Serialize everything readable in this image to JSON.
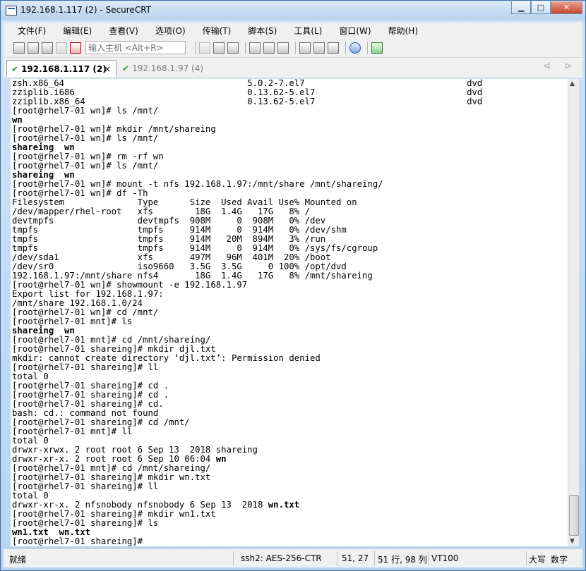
{
  "window": {
    "title": "192.168.1.117 (2) - SecureCRT",
    "minimize": "▁",
    "maximize": "□",
    "close": "✕"
  },
  "menu": [
    "文件(F)",
    "编辑(E)",
    "查看(V)",
    "选项(O)",
    "传输(T)",
    "脚本(S)",
    "工具(L)",
    "窗口(W)",
    "帮助(H)"
  ],
  "toolbar": {
    "host_input_placeholder": "输入主机 <Alt+R>"
  },
  "tabs": [
    {
      "label": "192.168.1.117 (2)",
      "close": "×",
      "status": "✔"
    },
    {
      "label": "192.168.1.97 (4)",
      "status": "✔"
    }
  ],
  "tab_nav": "◁ ▷",
  "terminal": {
    "lines": [
      {
        "t": "zsh.x86_64                                   5.0.2-7.el7                               dvd"
      },
      {
        "t": "zziplib.i686                                 0.13.62-5.el7                             dvd"
      },
      {
        "t": "zziplib.x86_64                               0.13.62-5.el7                             dvd"
      },
      {
        "t": "[root@rhel7-01 wn]# ls /mnt/"
      },
      {
        "t": "wn",
        "b": true
      },
      {
        "t": "[root@rhel7-01 wn]# mkdir /mnt/shareing"
      },
      {
        "t": "[root@rhel7-01 wn]# ls /mnt/"
      },
      {
        "t": "shareing  wn",
        "b": true
      },
      {
        "t": "[root@rhel7-01 wn]# rm -rf wn"
      },
      {
        "t": "[root@rhel7-01 wn]# ls /mnt/"
      },
      {
        "t": "shareing  wn",
        "b": true
      },
      {
        "t": "[root@rhel7-01 wn]# mount -t nfs 192.168.1.97:/mnt/share /mnt/shareing/"
      },
      {
        "t": "[root@rhel7-01 wn]# df -Th"
      },
      {
        "t": "Filesystem              Type      Size  Used Avail Use% Mounted on"
      },
      {
        "t": "/dev/mapper/rhel-root   xfs        18G  1.4G   17G   8% /"
      },
      {
        "t": "devtmpfs                devtmpfs  908M     0  908M   0% /dev"
      },
      {
        "t": "tmpfs                   tmpfs     914M     0  914M   0% /dev/shm"
      },
      {
        "t": "tmpfs                   tmpfs     914M   20M  894M   3% /run"
      },
      {
        "t": "tmpfs                   tmpfs     914M     0  914M   0% /sys/fs/cgroup"
      },
      {
        "t": "/dev/sda1               xfs       497M   96M  401M  20% /boot"
      },
      {
        "t": "/dev/sr0                iso9660   3.5G  3.5G     0 100% /opt/dvd"
      },
      {
        "t": "192.168.1.97:/mnt/share nfs4       18G  1.4G   17G   8% /mnt/shareing"
      },
      {
        "t": "[root@rhel7-01 wn]# showmount -e 192.168.1.97"
      },
      {
        "t": "Export list for 192.168.1.97:"
      },
      {
        "t": "/mnt/share 192.168.1.0/24"
      },
      {
        "t": "[root@rhel7-01 wn]# cd /mnt/"
      },
      {
        "t": "[root@rhel7-01 mnt]# ls"
      },
      {
        "t": "shareing  wn",
        "b": true
      },
      {
        "t": "[root@rhel7-01 mnt]# cd /mnt/shareing/"
      },
      {
        "t": "[root@rhel7-01 shareing]# mkdir djl.txt"
      },
      {
        "t": "mkdir: cannot create directory ‘djl.txt’: Permission denied"
      },
      {
        "t": "[root@rhel7-01 shareing]# ll"
      },
      {
        "t": "total 0"
      },
      {
        "t": "[root@rhel7-01 shareing]# cd ."
      },
      {
        "t": "[root@rhel7-01 shareing]# cd ."
      },
      {
        "t": "[root@rhel7-01 shareing]# cd."
      },
      {
        "t": "bash: cd.: command not found"
      },
      {
        "t": "[root@rhel7-01 shareing]# cd /mnt/"
      },
      {
        "t": "[root@rhel7-01 mnt]# ll"
      },
      {
        "t": "total 0"
      },
      {
        "t": "drwxr-xrwx. 2 root root 6 Sep 13  2018 shareing"
      },
      {
        "t": "drwxr-xr-x. 2 root root 6 Sep 10 06:04 ",
        "bt": "wn"
      },
      {
        "t": "[root@rhel7-01 mnt]# cd /mnt/shareing/"
      },
      {
        "t": "[root@rhel7-01 shareing]# mkdir wn.txt"
      },
      {
        "t": "[root@rhel7-01 shareing]# ll"
      },
      {
        "t": "total 0"
      },
      {
        "t": "drwxr-xr-x. 2 nfsnobody nfsnobody 6 Sep 13  2018 ",
        "bt": "wn.txt"
      },
      {
        "t": "[root@rhel7-01 shareing]# mkdir wn1.txt"
      },
      {
        "t": "[root@rhel7-01 shareing]# ls"
      },
      {
        "t": "wn1.txt  wn.txt",
        "b": true
      },
      {
        "t": "[root@rhel7-01 shareing]#"
      }
    ]
  },
  "status": {
    "ready": "就绪",
    "cipher": "ssh2: AES-256-CTR",
    "cursor": "51,  27",
    "position": "51 行, 98 列",
    "term": "VT100",
    "caps": "大写",
    "num": "数字"
  }
}
